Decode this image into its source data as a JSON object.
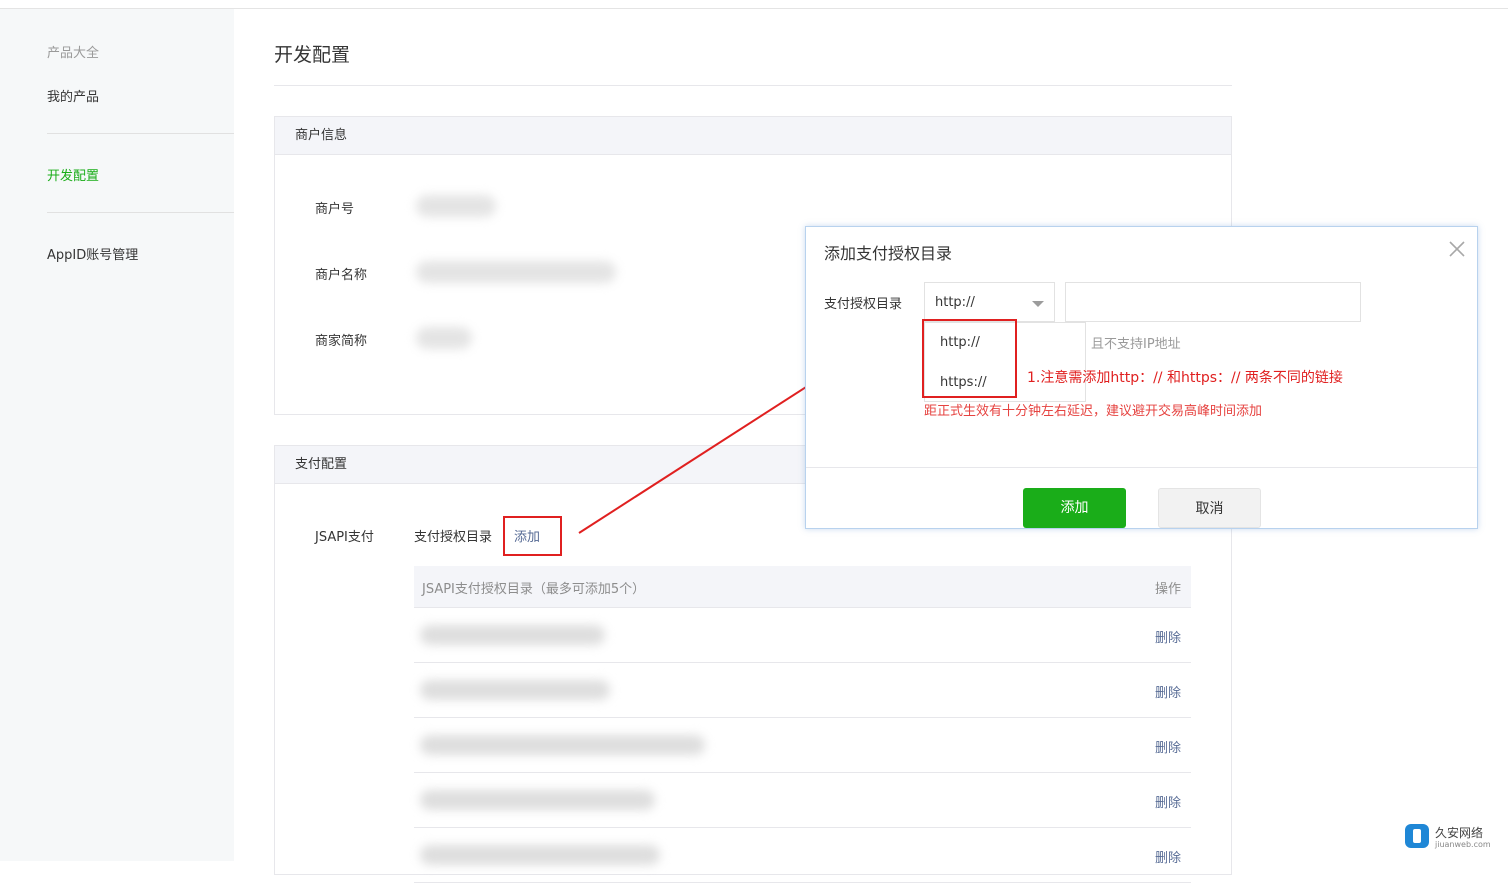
{
  "sidebar": {
    "group_title": "产品大全",
    "items": [
      {
        "label": "我的产品"
      },
      {
        "label": "开发配置"
      },
      {
        "label": "AppID账号管理"
      }
    ]
  },
  "page": {
    "title": "开发配置"
  },
  "merchant_panel": {
    "header": "商户信息",
    "fields": [
      {
        "label": "商户号"
      },
      {
        "label": "商户名称"
      },
      {
        "label": "商家简称"
      }
    ]
  },
  "pay_panel": {
    "header": "支付配置",
    "jsapi_label": "JSAPI支付",
    "dir_label": "支付授权目录",
    "add_link": "添加",
    "table": {
      "col_dir": "JSAPI支付授权目录（最多可添加5个）",
      "col_op": "操作",
      "rows": [
        {
          "action": "删除"
        },
        {
          "action": "删除"
        },
        {
          "action": "删除"
        },
        {
          "action": "删除"
        },
        {
          "action": "删除"
        }
      ]
    }
  },
  "dialog": {
    "title": "添加支付授权目录",
    "field_label": "支付授权目录",
    "protocol_selected": "http://",
    "protocol_options": [
      "http://",
      "https://"
    ],
    "input_value": "",
    "tip": "且不支持IP地址",
    "warning": "距正式生效有十分钟左右延迟，建议避开交易高峰时间添加",
    "annotation": "1.注意需添加http：// 和https：// 两条不同的链接",
    "ok_label": "添加",
    "cancel_label": "取消"
  },
  "watermark": {
    "name": "久安网络",
    "domain": "jiuanweb.com"
  },
  "colors": {
    "brand_green": "#1aad19",
    "link_blue": "#576b95",
    "annot_red": "#e02020"
  }
}
